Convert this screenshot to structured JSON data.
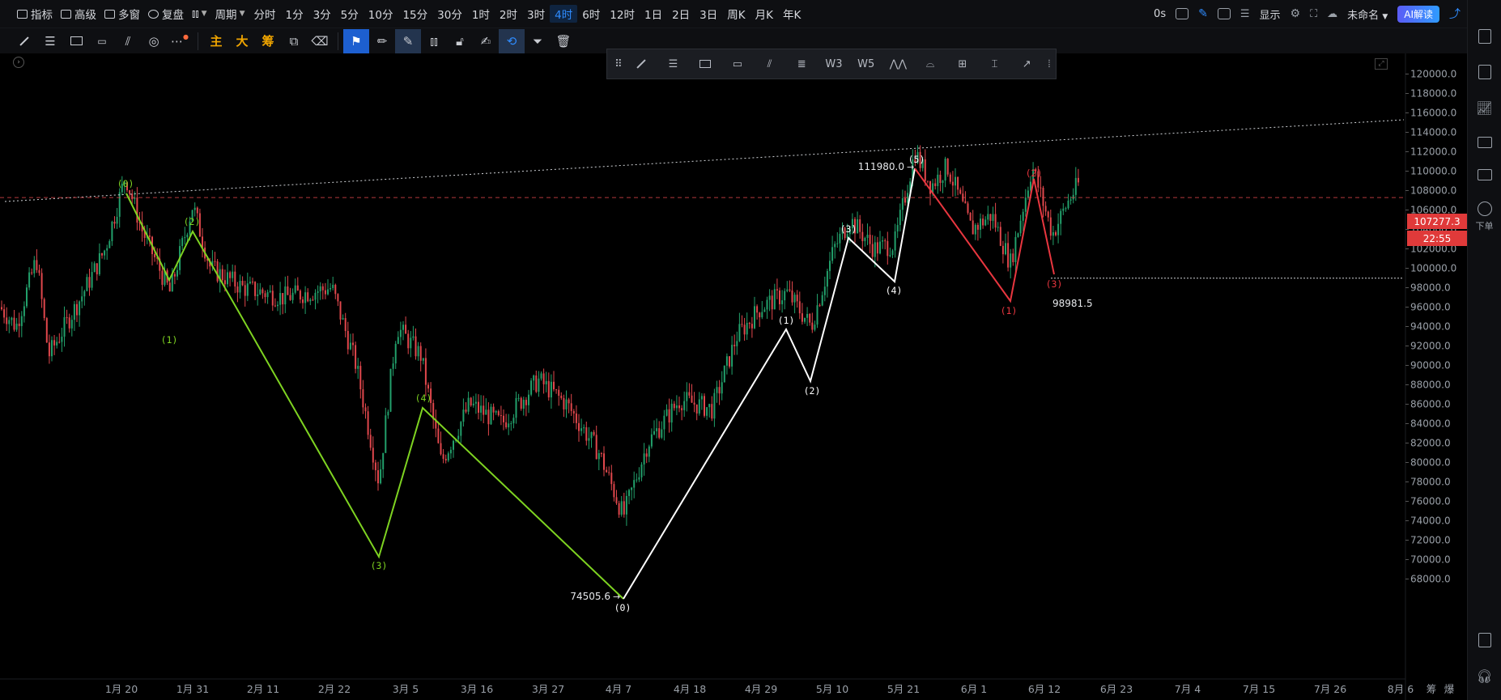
{
  "topbar": {
    "items": [
      {
        "label": "指标",
        "icon": "indicator-icon"
      },
      {
        "label": "高级",
        "icon": "advanced-icon"
      },
      {
        "label": "多窗",
        "icon": "multi-window-icon"
      },
      {
        "label": "复盘",
        "icon": "replay-icon"
      }
    ],
    "chart_type_icon": "candlestick-icon",
    "period_label": "周期",
    "periods": [
      "分时",
      "1分",
      "3分",
      "5分",
      "10分",
      "15分",
      "30分",
      "1时",
      "2时",
      "3时",
      "4时",
      "6时",
      "12时",
      "1日",
      "2日",
      "3日",
      "周K",
      "月K",
      "年K"
    ],
    "active_period": "4时",
    "right": {
      "latency": "0s",
      "display_label": "显示",
      "layout_name": "未命名",
      "ai_label": "AI解读"
    }
  },
  "toolbar2": {
    "cn_tools": [
      "主",
      "大",
      "筹"
    ]
  },
  "floattools": {
    "labels": [
      "W3",
      "W5"
    ]
  },
  "chart": {
    "y_ticks": [
      "120000.0",
      "118000.0",
      "116000.0",
      "114000.0",
      "112000.0",
      "110000.0",
      "108000.0",
      "106000.0",
      "104000.0",
      "102000.0",
      "100000.0",
      "98000.0",
      "96000.0",
      "94000.0",
      "92000.0",
      "90000.0",
      "88000.0",
      "86000.0",
      "84000.0",
      "82000.0",
      "80000.0",
      "78000.0",
      "76000.0",
      "74000.0",
      "72000.0",
      "70000.0",
      "68000.0"
    ],
    "x_ticks": [
      "1月 20",
      "1月 31",
      "2月 11",
      "2月 22",
      "3月 5",
      "3月 16",
      "3月 27",
      "4月 7",
      "4月 18",
      "4月 29",
      "5月 10",
      "5月 21",
      "6月 1",
      "6月 12",
      "6月 23",
      "7月 4",
      "7月 15",
      "7月 26",
      "8月 6"
    ],
    "x_axis_right": [
      "筹",
      "爆"
    ],
    "current_price": "107277.3",
    "countdown": "22:55",
    "annotations": {
      "high": "111980.0",
      "low": "74505.6",
      "level": "98981.5"
    },
    "green_wave_labels": [
      "(0)",
      "(1)",
      "(2)",
      "(3)",
      "(4)"
    ],
    "white_wave_labels": [
      "(0)",
      "(1)",
      "(2)",
      "(3)",
      "(4)",
      "(5)"
    ],
    "red_wave_labels": [
      "(1)",
      "(2)",
      "(3)"
    ],
    "colors": {
      "green_wave": "#7ed321",
      "white_wave": "#ffffff",
      "red_wave": "#e8363f",
      "candle_up": "#22a06b",
      "candle_down": "#e0474c",
      "price_line": "#e0474c"
    }
  },
  "sidebar": {
    "order_label": "下单"
  }
}
